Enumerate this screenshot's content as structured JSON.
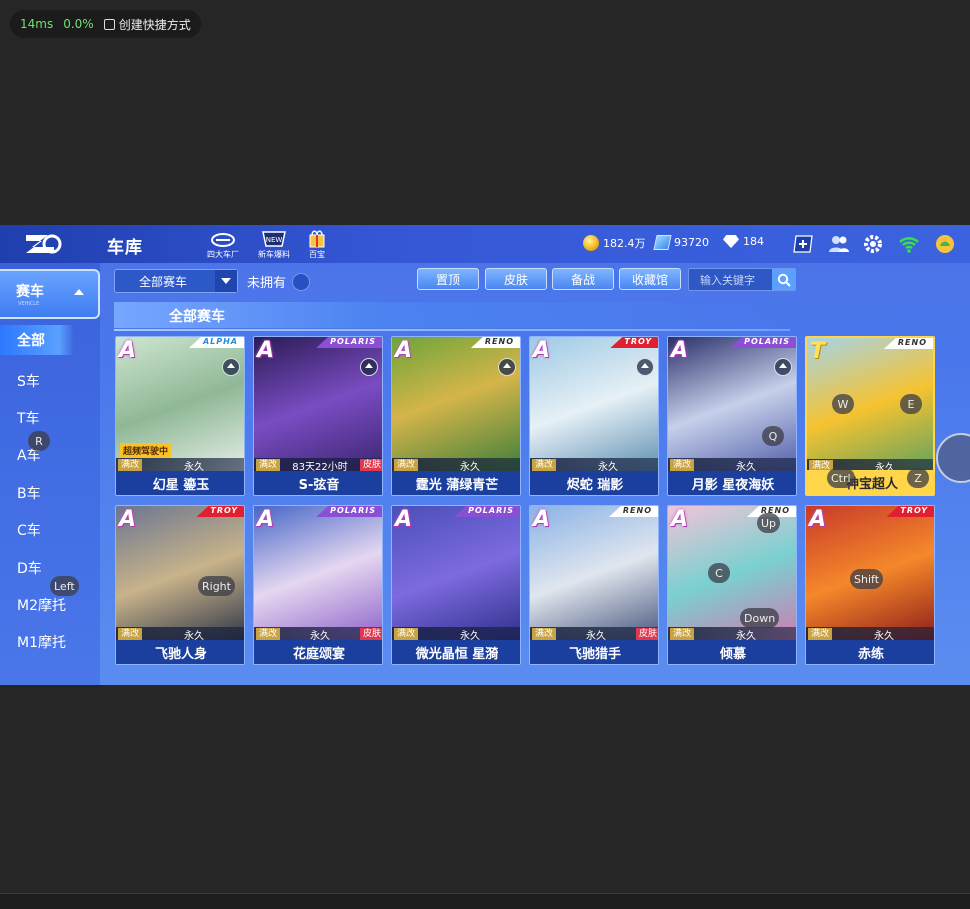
{
  "overlay": {
    "latency": "14ms",
    "loss": "0.0%",
    "shortcut": "创建快捷方式"
  },
  "header": {
    "title": "车库",
    "icons": [
      {
        "name": "factory-icon",
        "label": "四大车厂"
      },
      {
        "name": "new-car-icon",
        "label": "新车爆料"
      },
      {
        "name": "gift-icon",
        "label": "百宝"
      }
    ],
    "currency": {
      "coins": "182.4万",
      "gems": "93720",
      "diamonds": "184"
    }
  },
  "sidebar": {
    "title": "赛车",
    "subtitle": "VEHICLE",
    "items": [
      "全部",
      "S车",
      "T车",
      "A车",
      "B车",
      "C车",
      "D车",
      "M2摩托",
      "M1摩托"
    ]
  },
  "toolbar": {
    "filter": "全部赛车",
    "unowned": "未拥有",
    "buttons": [
      "置顶",
      "皮肤",
      "备战",
      "收藏馆"
    ],
    "search_placeholder": "输入关键字"
  },
  "section_title": "全部赛车",
  "cars": [
    {
      "cls": "A",
      "brand": "ALPHA",
      "name": "幻星 鎏玉",
      "mod": "满改",
      "duration": "永久",
      "tag": "超频驾驶中",
      "skin": "",
      "equip": true
    },
    {
      "cls": "A",
      "brand": "POLARIS",
      "name": "S-弦音",
      "mod": "满改",
      "duration": "83天22小时",
      "tag": "",
      "skin": "皮肤",
      "equip": true
    },
    {
      "cls": "A",
      "brand": "RENO",
      "name": "霆光 蒲绿青芒",
      "mod": "满改",
      "duration": "永久",
      "tag": "",
      "skin": "",
      "equip": true
    },
    {
      "cls": "A",
      "brand": "TROY",
      "name": "烬蛇 瑞影",
      "mod": "满改",
      "duration": "永久",
      "tag": "",
      "skin": "",
      "equip": true
    },
    {
      "cls": "A",
      "brand": "POLARIS",
      "name": "月影 星夜海妖",
      "mod": "满改",
      "duration": "永久",
      "tag": "",
      "skin": "",
      "equip": true
    },
    {
      "cls": "T",
      "brand": "RENO",
      "name": "神宝超人",
      "mod": "满改",
      "duration": "永久",
      "tag": "",
      "skin": "",
      "equip": false
    },
    {
      "cls": "A",
      "brand": "TROY",
      "name": "飞驰人身",
      "mod": "满改",
      "duration": "永久",
      "tag": "",
      "skin": "",
      "equip": false
    },
    {
      "cls": "A",
      "brand": "POLARIS",
      "name": "花庭颂宴",
      "mod": "满改",
      "duration": "永久",
      "tag": "",
      "skin": "皮肤",
      "equip": false
    },
    {
      "cls": "A",
      "brand": "POLARIS",
      "name": "微光晶恒 星漪",
      "mod": "满改",
      "duration": "永久",
      "tag": "",
      "skin": "",
      "equip": false
    },
    {
      "cls": "A",
      "brand": "RENO",
      "name": "飞驰猎手",
      "mod": "满改",
      "duration": "永久",
      "tag": "",
      "skin": "皮肤",
      "equip": false
    },
    {
      "cls": "A",
      "brand": "RENO",
      "name": "倾慕",
      "mod": "满改",
      "duration": "永久",
      "tag": "",
      "skin": "",
      "equip": false
    },
    {
      "cls": "A",
      "brand": "TROY",
      "name": "赤练",
      "mod": "满改",
      "duration": "永久",
      "tag": "",
      "skin": "",
      "equip": false
    }
  ],
  "keyhints": [
    "R",
    "Left",
    "Right",
    "W",
    "E",
    "Q",
    "Ctrl",
    "Z",
    "Up",
    "C",
    "Down",
    "Shift"
  ],
  "colors": {
    "accent": "#4a78ec",
    "gold": "#ffd54a",
    "skin": "#e2384f"
  }
}
